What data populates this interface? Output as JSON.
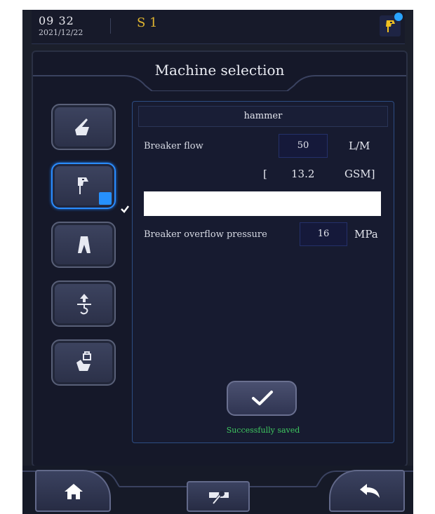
{
  "status": {
    "time": "09 32",
    "date": "2021/12/22",
    "mode": "S 1",
    "tool_icon": "breaker-icon",
    "badge_icon": "check-badge-icon"
  },
  "screen": {
    "title": "Machine selection"
  },
  "tools": [
    {
      "name": "bucket",
      "icon": "bucket-icon",
      "selected": false
    },
    {
      "name": "hammer",
      "icon": "hammer-icon",
      "selected": true
    },
    {
      "name": "shear",
      "icon": "shear-icon",
      "selected": false
    },
    {
      "name": "lift",
      "icon": "lift-hook-icon",
      "selected": false
    },
    {
      "name": "quick-coupler",
      "icon": "coupler-icon",
      "selected": false
    }
  ],
  "panel": {
    "machine": "hammer",
    "breaker_flow_label": "Breaker flow",
    "breaker_flow_value": "50",
    "breaker_flow_unit": "L/M",
    "bracket_open": "[",
    "gsm_value": "13.2",
    "gsm_unit": "GSM]",
    "overflow_label": "Breaker overflow pressure",
    "overflow_value": "16",
    "overflow_unit": "MPa",
    "save_status": "Successfully saved"
  },
  "colors": {
    "accent": "#2a8cff",
    "success": "#3fc860",
    "mode": "#e0b530"
  },
  "nav": {
    "home_icon": "home-icon",
    "settings_icon": "wrench-icon",
    "back_icon": "back-arrow-icon"
  }
}
